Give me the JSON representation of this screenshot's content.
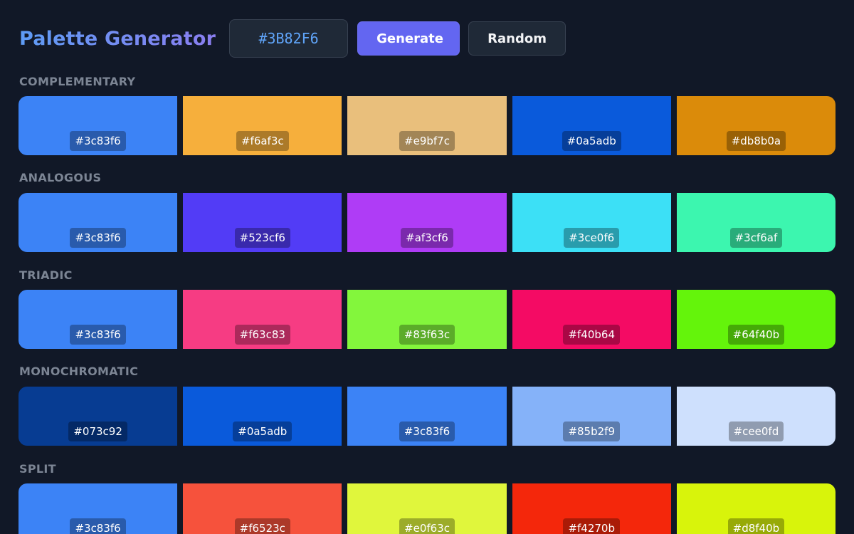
{
  "header": {
    "title": "Palette Generator",
    "hex_value": "#3B82F6",
    "generate_label": "Generate",
    "random_label": "Random"
  },
  "sections": [
    {
      "label": "COMPLEMENTARY",
      "colors": [
        "#3c83f6",
        "#f6af3c",
        "#e9bf7c",
        "#0a5adb",
        "#db8b0a"
      ]
    },
    {
      "label": "ANALOGOUS",
      "colors": [
        "#3c83f6",
        "#523cf6",
        "#af3cf6",
        "#3ce0f6",
        "#3cf6af"
      ]
    },
    {
      "label": "TRIADIC",
      "colors": [
        "#3c83f6",
        "#f63c83",
        "#83f63c",
        "#f40b64",
        "#64f40b"
      ]
    },
    {
      "label": "MONOCHROMATIC",
      "colors": [
        "#073c92",
        "#0a5adb",
        "#3c83f6",
        "#85b2f9",
        "#cee0fd"
      ]
    },
    {
      "label": "SPLIT",
      "colors": [
        "#3c83f6",
        "#f6523c",
        "#e0f63c",
        "#f4270b",
        "#d8f40b"
      ]
    }
  ]
}
